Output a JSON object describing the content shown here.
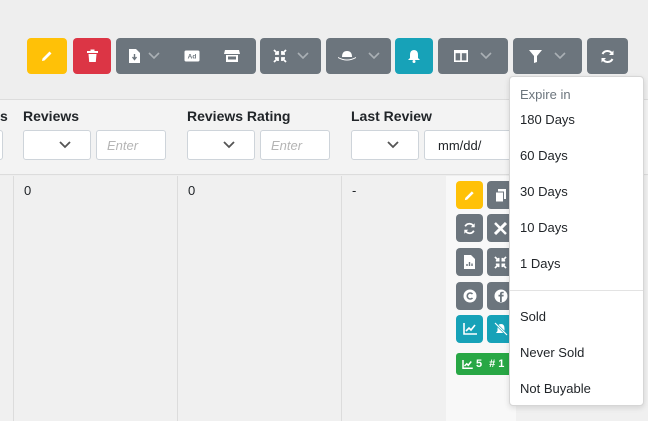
{
  "toolbar": {
    "buttons": {
      "edit": "pencil-icon",
      "delete": "trash-icon",
      "export": "file-download-icon",
      "ad": "ad-icon",
      "store": "store-icon",
      "compress": "compress-icon",
      "hat": "hat-icon",
      "notify": "bell-icon",
      "columns": "columns-icon",
      "filter": "filter-icon",
      "refresh": "sync-icon"
    },
    "ad_label": "Ad"
  },
  "columns": {
    "partial_label": "s",
    "reviews": "Reviews",
    "reviews_rating": "Reviews Rating",
    "last_review": "Last Review"
  },
  "filters": {
    "reviews_placeholder": "Enter",
    "reviews_rating_placeholder": "Enter",
    "last_review_date": "mm/dd/"
  },
  "row": {
    "reviews": "0",
    "reviews_rating": "0",
    "last_review": "-"
  },
  "badge": {
    "count": "5",
    "hash": "# 1"
  },
  "dropdown": {
    "header": "Expire in",
    "expire_items": [
      "180 Days",
      "60 Days",
      "30 Days",
      "10 Days",
      "1 Days"
    ],
    "status_items": [
      "Sold",
      "Never Sold",
      "Not Buyable"
    ]
  },
  "colors": {
    "yellow": "#ffc107",
    "red": "#dc3545",
    "gray": "#6c757d",
    "teal": "#17a2b8",
    "green": "#28a745"
  }
}
